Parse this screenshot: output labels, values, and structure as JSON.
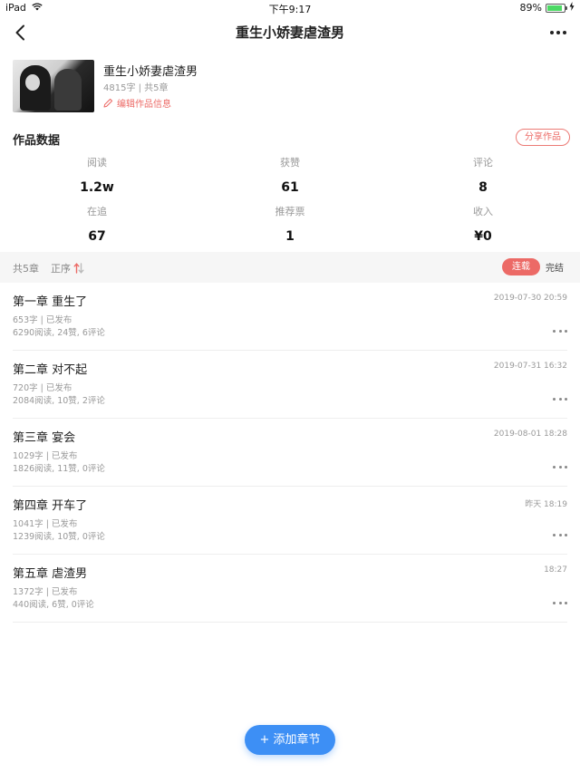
{
  "status_bar": {
    "device": "iPad",
    "time": "下午9:17",
    "battery": "89%",
    "battery_level": 0.89
  },
  "nav": {
    "title": "重生小娇妻虐渣男"
  },
  "book": {
    "title": "重生小娇妻虐渣男",
    "meta": "4815字 | 共5章",
    "edit_label": "编辑作品信息"
  },
  "stats": {
    "title": "作品数据",
    "share_label": "分享作品",
    "items": [
      {
        "label": "阅读",
        "value": "1.2w"
      },
      {
        "label": "获赞",
        "value": "61"
      },
      {
        "label": "评论",
        "value": "8"
      },
      {
        "label": "在追",
        "value": "67"
      },
      {
        "label": "推荐票",
        "value": "1"
      },
      {
        "label": "收入",
        "value": "¥0"
      }
    ]
  },
  "toolbar": {
    "count": "共5章",
    "order_label": "正序",
    "tabs": [
      "连载",
      "完结"
    ]
  },
  "chapters": [
    {
      "title": "第一章 重生了",
      "date": "2019-07-30 20:59",
      "meta1": "653字 | 已发布",
      "meta2": "6290阅读, 24赞, 6评论"
    },
    {
      "title": "第二章 对不起",
      "date": "2019-07-31 16:32",
      "meta1": "720字 | 已发布",
      "meta2": "2084阅读, 10赞, 2评论"
    },
    {
      "title": "第三章 宴会",
      "date": "2019-08-01 18:28",
      "meta1": "1029字 | 已发布",
      "meta2": "1826阅读, 11赞, 0评论"
    },
    {
      "title": "第四章 开车了",
      "date": "昨天 18:19",
      "meta1": "1041字 | 已发布",
      "meta2": "1239阅读, 10赞, 0评论"
    },
    {
      "title": "第五章 虐渣男",
      "date": "18:27",
      "meta1": "1372字 | 已发布",
      "meta2": "440阅读, 6赞, 0评论"
    }
  ],
  "add_button": {
    "label": "+ 添加章节"
  },
  "colors": {
    "accent": "#ec6a66",
    "primary_button": "#3d8ff5",
    "battery": "#4cd964"
  },
  "icons": [
    "wifi-icon",
    "battery-icon",
    "charging-icon",
    "back-chevron-icon",
    "more-icon",
    "pencil-icon",
    "sort-icon"
  ]
}
